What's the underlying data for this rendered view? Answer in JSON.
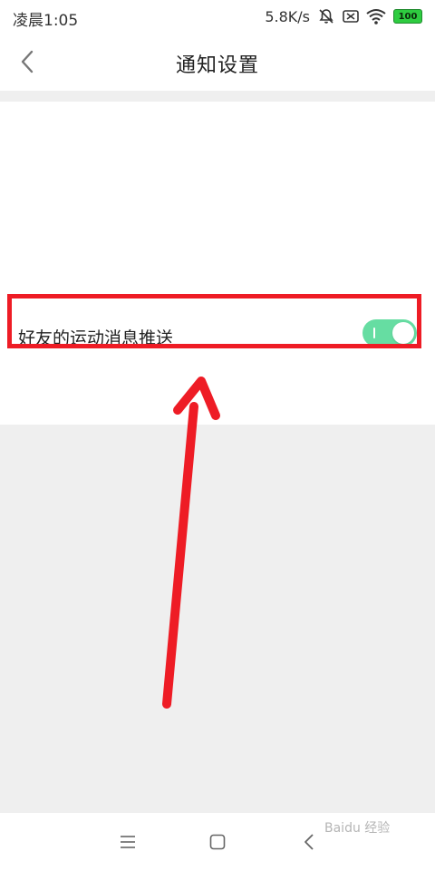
{
  "status_bar": {
    "time": "凌晨1:05",
    "speed": "5.8K/s",
    "battery": "100",
    "icons": [
      "mute-icon",
      "sim-icon",
      "wifi-icon",
      "battery-icon"
    ]
  },
  "nav": {
    "title": "通知设置",
    "back_icon": "chevron-left-icon"
  },
  "settings": {
    "friend_push": {
      "label": "好友的运动消息推送",
      "enabled": true
    }
  },
  "bottom_nav": {
    "keys": [
      "menu-icon",
      "home-icon",
      "back-icon"
    ]
  },
  "watermark": "Baidu 经验",
  "colors": {
    "toggle_on": "#66dda2",
    "highlight": "#ee1c25",
    "background": "#efefef"
  }
}
